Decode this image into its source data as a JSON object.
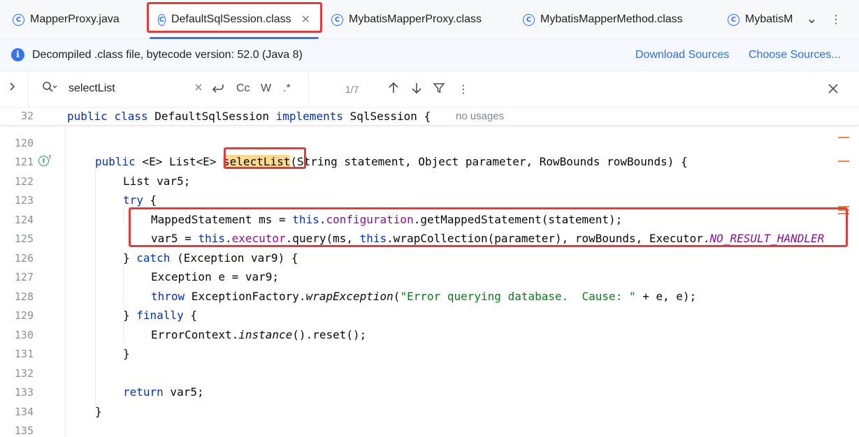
{
  "tabs": [
    {
      "label": "MapperProxy.java",
      "active": false
    },
    {
      "label": "DefaultSqlSession.class",
      "active": true
    },
    {
      "label": "MybatisMapperProxy.class",
      "active": false
    },
    {
      "label": "MybatisMapperMethod.class",
      "active": false
    },
    {
      "label": "MybatisM",
      "active": false
    }
  ],
  "tab_icon_glyph": "C",
  "tab_close_glyph": "✕",
  "tab_overflow_glyph": "⌄",
  "tab_menu_glyph": "⋮",
  "banner": {
    "message": "Decompiled .class file, bytecode version: 52.0 (Java 8)",
    "download_sources": "Download Sources",
    "choose_sources": "Choose Sources..."
  },
  "search": {
    "query": "selectList",
    "match_count": "1/7",
    "match_case_label": "Cc",
    "whole_words_label": "W",
    "regex_label": ".*"
  },
  "sticky_line": {
    "number": "32",
    "no_usages": "no usages"
  },
  "line_numbers": [
    "120",
    "121",
    "122",
    "123",
    "124",
    "125",
    "126",
    "127",
    "128",
    "129",
    "130",
    "131",
    "132",
    "133",
    "134",
    "135"
  ],
  "code": {
    "l121_kw": "public",
    "l121_gen": " <E> List<E> ",
    "l121_method": "selectList",
    "l121_rest": "(String statement, Object parameter, RowBounds rowBounds) {",
    "l122": "List var5;",
    "l123_kw": "try",
    "l123_rest": " {",
    "l124_a": "MappedStatement ms = ",
    "l124_this": "this",
    "l124_dot": ".",
    "l124_field": "configuration",
    "l124_rest": ".getMappedStatement(statement);",
    "l125_a": "var5 = ",
    "l125_this": "this",
    "l125_dot": ".",
    "l125_field": "executor",
    "l125_b": ".query(ms, ",
    "l125_this2": "this",
    "l125_c": ".wrapCollection(parameter), rowBounds, Executor.",
    "l125_const": "NO_RESULT_HANDLER",
    "l126_a": "} ",
    "l126_kw": "catch",
    "l126_rest": " (Exception var9) {",
    "l127": "Exception e = var9;",
    "l128_kw": "throw",
    "l128_a": " ExceptionFactory.",
    "l128_method": "wrapException",
    "l128_b": "(",
    "l128_str": "\"Error querying database.  Cause: \"",
    "l128_c": " + e, e);",
    "l129_a": "} ",
    "l129_kw": "finally",
    "l129_rest": " {",
    "l130_a": "ErrorContext.",
    "l130_method": "instance",
    "l130_rest": "().reset();",
    "l131": "}",
    "l133_kw": "return",
    "l133_rest": " var5;",
    "l134": "}",
    "sticky_kw1": "public",
    "sticky_kw2": "class",
    "sticky_name": " DefaultSqlSession ",
    "sticky_kw3": "implements",
    "sticky_rest": " SqlSession {"
  },
  "colors": {
    "accent": "#3574f0",
    "highlight_box": "#e03c3c",
    "search_highlight": "#fcd98c"
  }
}
